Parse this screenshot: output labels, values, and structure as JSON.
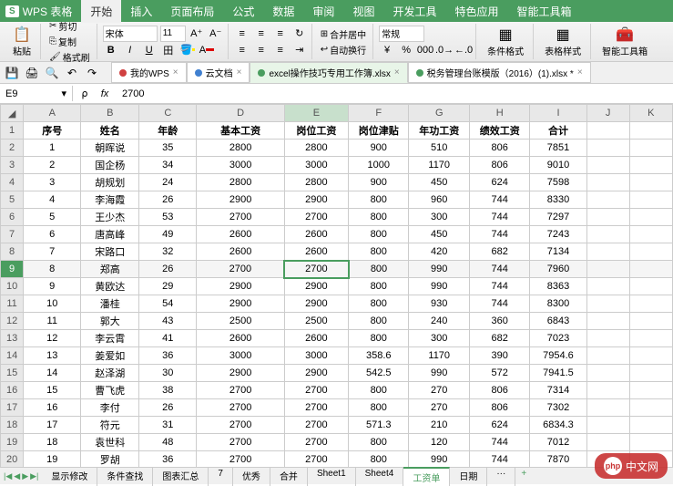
{
  "app": {
    "logo": "S",
    "name": "WPS 表格"
  },
  "menu": {
    "tabs": [
      "开始",
      "插入",
      "页面布局",
      "公式",
      "数据",
      "审阅",
      "视图",
      "开发工具",
      "特色应用",
      "智能工具箱"
    ],
    "active": 0
  },
  "ribbon": {
    "paste": "粘贴",
    "cut": "剪切",
    "copy": "复制",
    "format_painter": "格式刷",
    "font_name": "宋体",
    "font_size": "11",
    "merge_center": "合并居中",
    "auto_wrap": "自动换行",
    "number_format": "常规",
    "cond_format": "条件格式",
    "table_style": "表格样式",
    "smart_tools": "智能工具箱"
  },
  "quickbar": {
    "docs": [
      {
        "label": "我的WPS",
        "color": "#d04040"
      },
      {
        "label": "云文档",
        "color": "#4080d0"
      },
      {
        "label": "excel操作技巧专用工作簿.xlsx",
        "active": true,
        "color": "#4a9d5f"
      },
      {
        "label": "税务管理台账模版（2016）(1).xlsx *",
        "color": "#4a9d5f"
      }
    ]
  },
  "formula": {
    "cell_ref": "E9",
    "value": "2700"
  },
  "columns": [
    "A",
    "B",
    "C",
    "D",
    "E",
    "F",
    "G",
    "H",
    "I",
    "J",
    "K"
  ],
  "headers": [
    "序号",
    "姓名",
    "年龄",
    "基本工资",
    "岗位工资",
    "岗位津贴",
    "年功工资",
    "绩效工资",
    "合计"
  ],
  "rows": [
    {
      "n": 1,
      "d": [
        "1",
        "朝晖说",
        "35",
        "2800",
        "2800",
        "900",
        "510",
        "806",
        "7851"
      ]
    },
    {
      "n": 2,
      "d": [
        "2",
        "国企杨",
        "34",
        "3000",
        "3000",
        "1000",
        "1170",
        "806",
        "9010"
      ]
    },
    {
      "n": 3,
      "d": [
        "3",
        "胡规划",
        "24",
        "2800",
        "2800",
        "900",
        "450",
        "624",
        "7598"
      ]
    },
    {
      "n": 4,
      "d": [
        "4",
        "李海霞",
        "26",
        "2900",
        "2900",
        "800",
        "960",
        "744",
        "8330"
      ]
    },
    {
      "n": 5,
      "d": [
        "5",
        "王少杰",
        "53",
        "2700",
        "2700",
        "800",
        "300",
        "744",
        "7297"
      ]
    },
    {
      "n": 6,
      "d": [
        "6",
        "唐高峰",
        "49",
        "2600",
        "2600",
        "800",
        "450",
        "744",
        "7243"
      ]
    },
    {
      "n": 7,
      "d": [
        "7",
        "宋路口",
        "32",
        "2600",
        "2600",
        "800",
        "420",
        "682",
        "7134"
      ]
    },
    {
      "n": 8,
      "d": [
        "8",
        "郑高",
        "26",
        "2700",
        "2700",
        "800",
        "990",
        "744",
        "7960"
      ]
    },
    {
      "n": 9,
      "d": [
        "9",
        "黄欧达",
        "29",
        "2900",
        "2900",
        "800",
        "990",
        "744",
        "8363"
      ]
    },
    {
      "n": 10,
      "d": [
        "10",
        "潘桂",
        "54",
        "2900",
        "2900",
        "800",
        "930",
        "744",
        "8300"
      ]
    },
    {
      "n": 11,
      "d": [
        "11",
        "郭大",
        "43",
        "2500",
        "2500",
        "800",
        "240",
        "360",
        "6843"
      ]
    },
    {
      "n": 12,
      "d": [
        "12",
        "李云霄",
        "41",
        "2600",
        "2600",
        "800",
        "300",
        "682",
        "7023"
      ]
    },
    {
      "n": 13,
      "d": [
        "13",
        "姜爱如",
        "36",
        "3000",
        "3000",
        "358.6",
        "1170",
        "390",
        "7954.6"
      ]
    },
    {
      "n": 14,
      "d": [
        "14",
        "赵泽湖",
        "30",
        "2900",
        "2900",
        "542.5",
        "990",
        "572",
        "7941.5"
      ]
    },
    {
      "n": 15,
      "d": [
        "15",
        "曹飞虎",
        "38",
        "2700",
        "2700",
        "800",
        "270",
        "806",
        "7314"
      ]
    },
    {
      "n": 16,
      "d": [
        "16",
        "李付",
        "26",
        "2700",
        "2700",
        "800",
        "270",
        "806",
        "7302"
      ]
    },
    {
      "n": 17,
      "d": [
        "17",
        "符元",
        "31",
        "2700",
        "2700",
        "571.3",
        "210",
        "624",
        "6834.3"
      ]
    },
    {
      "n": 18,
      "d": [
        "18",
        "袁世科",
        "48",
        "2700",
        "2700",
        "800",
        "120",
        "744",
        "7012"
      ]
    },
    {
      "n": 19,
      "d": [
        "19",
        "罗胡",
        "36",
        "2700",
        "2700",
        "800",
        "990",
        "744",
        "7870"
      ]
    }
  ],
  "active_row": 9,
  "sheets": {
    "tabs": [
      "显示修改",
      "条件查找",
      "图表汇总",
      "7",
      "优秀",
      "合并",
      "Sheet1",
      "Sheet4",
      "工资单",
      "日期"
    ],
    "active": 8,
    "more": "···",
    "add": "+"
  },
  "watermark": {
    "logo": "php",
    "text": "中文网"
  }
}
